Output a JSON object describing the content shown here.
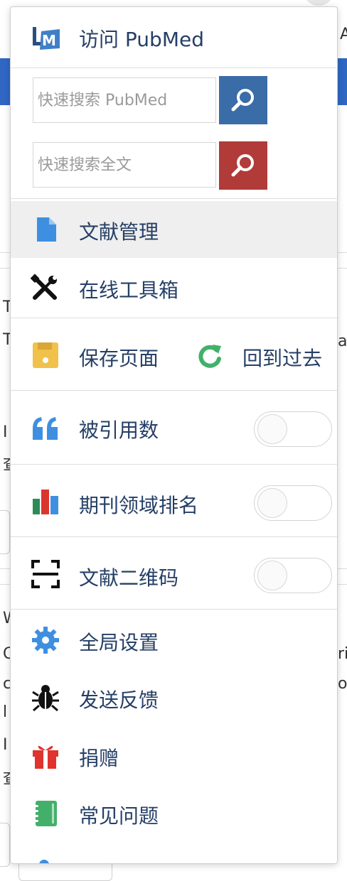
{
  "header": {
    "title": "访问 PubMed",
    "logo_icon": "pubmed-logo-icon"
  },
  "search": {
    "pubmed_placeholder": "快速搜索 PubMed",
    "fulltext_placeholder": "快速搜索全文",
    "pubmed_button_color": "#3a6ca8",
    "fulltext_button_color": "#b13b38"
  },
  "menu": {
    "library": {
      "label": "文献管理",
      "icon": "document-icon",
      "color": "#3f8fe0"
    },
    "toolbox": {
      "label": "在线工具箱",
      "icon": "wrench-screwdriver-icon",
      "color": "#111111"
    },
    "save_page": {
      "label": "保存页面",
      "icon": "floppy-disk-icon",
      "color": "#f0c24c"
    },
    "go_back": {
      "label": "回到过去",
      "icon": "refresh-icon",
      "color": "#43b06a"
    },
    "citations": {
      "label": "被引用数",
      "icon": "quote-icon",
      "color": "#3f8fe0",
      "enabled": false
    },
    "journal_rank": {
      "label": "期刊领域排名",
      "icon": "bar-chart-icon",
      "enabled": false
    },
    "qr_code": {
      "label": "文献二维码",
      "icon": "scan-qr-icon",
      "enabled": false
    },
    "settings": {
      "label": "全局设置",
      "icon": "gear-icon",
      "color": "#3f8fe0"
    },
    "feedback": {
      "label": "发送反馈",
      "icon": "bug-icon",
      "color": "#111111"
    },
    "donate": {
      "label": "捐赠",
      "icon": "gift-icon",
      "color": "#e0322f"
    },
    "faq": {
      "label": "常见问题",
      "icon": "notebook-icon",
      "color": "#43b06a"
    }
  },
  "background": {
    "frag_1": "T",
    "frag_2": "T",
    "frag_3": "I",
    "frag_4": "查",
    "frag_5": "W",
    "frag_6": "C",
    "frag_7": "c",
    "frag_8": "l",
    "frag_9": "I",
    "frag_10": "查",
    "frag_11": "a",
    "frag_12": "ri",
    "frag_13": "or",
    "frag_14": "A",
    "brand_color": "#2f67c3"
  }
}
